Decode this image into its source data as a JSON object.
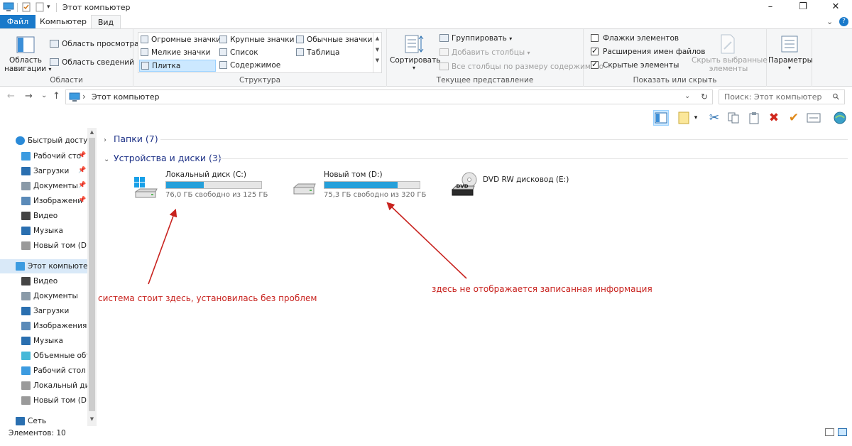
{
  "window": {
    "title": "Этот компьютер",
    "minimize_glyph": "–",
    "maximize_glyph": "❐",
    "close_glyph": "✕",
    "accent": "#1979ca"
  },
  "tabs": {
    "file": "Файл",
    "computer": "Компьютер",
    "view": "Вид"
  },
  "ribbon": {
    "collapse_glyph": "⌄",
    "help_glyph": "?",
    "panes": {
      "nav_pane_line1": "Область",
      "nav_pane_line2": "навигации",
      "preview_pane": "Область просмотра",
      "details_pane": "Область сведений",
      "label": "Области"
    },
    "layout": {
      "items": [
        "Огромные значки",
        "Крупные значки",
        "Обычные значки",
        "Мелкие значки",
        "Список",
        "Таблица",
        "Плитка",
        "Содержимое"
      ],
      "selected": "Плитка",
      "label": "Структура"
    },
    "current_view": {
      "sort": "Сортировать",
      "group": "Группировать",
      "add_columns": "Добавить столбцы",
      "fit_columns": "Все столбцы по размеру содержимого",
      "label": "Текущее представление"
    },
    "show_hide": {
      "item_checkboxes": "Флажки элементов",
      "item_checkboxes_checked": false,
      "file_extensions": "Расширения имен файлов",
      "file_extensions_checked": true,
      "hidden_items": "Скрытые элементы",
      "hidden_items_checked": true,
      "hide_selected_line1": "Скрыть выбранные",
      "hide_selected_line2": "элементы",
      "label": "Показать или скрыть"
    },
    "options": {
      "label": "Параметры"
    }
  },
  "address": {
    "path": "Этот компьютер",
    "search_placeholder": "Поиск: Этот компьютер",
    "back_glyph": "←",
    "forward_glyph": "→",
    "recent_glyph": "⌄",
    "up_glyph": "↑",
    "chevron": "›",
    "dropdown_glyph": "⌄",
    "refresh_glyph": "↻",
    "search_glyph": "⚲"
  },
  "nav": {
    "items": [
      {
        "label": "Быстрый доступ",
        "icon": "star-icon",
        "pinned": false
      },
      {
        "label": "Рабочий сто",
        "icon": "desktop-icon",
        "pinned": true
      },
      {
        "label": "Загрузки",
        "icon": "download-icon",
        "pinned": true
      },
      {
        "label": "Документы",
        "icon": "document-icon",
        "pinned": true
      },
      {
        "label": "Изображени",
        "icon": "pictures-icon",
        "pinned": true
      },
      {
        "label": "Видео",
        "icon": "video-icon",
        "pinned": false
      },
      {
        "label": "Музыка",
        "icon": "music-icon",
        "pinned": false
      },
      {
        "label": "Новый том (D:)",
        "icon": "drive-icon",
        "pinned": false
      },
      {
        "label": "Этот компьютер",
        "icon": "computer-icon",
        "pinned": false
      },
      {
        "label": "Видео",
        "icon": "video-icon",
        "pinned": false
      },
      {
        "label": "Документы",
        "icon": "document-icon",
        "pinned": false
      },
      {
        "label": "Загрузки",
        "icon": "download-icon",
        "pinned": false
      },
      {
        "label": "Изображения",
        "icon": "pictures-icon",
        "pinned": false
      },
      {
        "label": "Музыка",
        "icon": "music-icon",
        "pinned": false
      },
      {
        "label": "Объемные объ",
        "icon": "3d-objects-icon",
        "pinned": false
      },
      {
        "label": "Рабочий стол",
        "icon": "desktop-icon",
        "pinned": false
      },
      {
        "label": "Локальный дис",
        "icon": "drive-icon",
        "pinned": false
      },
      {
        "label": "Новый том (D:)",
        "icon": "drive-icon",
        "pinned": false
      },
      {
        "label": "Сеть",
        "icon": "network-icon",
        "pinned": false
      }
    ],
    "selected": "Этот компьютер",
    "pin_glyph": "📌",
    "scroll_up_glyph": "▲",
    "scroll_down_glyph": "▼"
  },
  "content": {
    "folders_header": "Папки (7)",
    "devices_header": "Устройства и диски (3)",
    "collapsed_glyph": "›",
    "expanded_glyph": "⌄",
    "drives": [
      {
        "name": "Локальный диск (C:)",
        "free_text": "76,0 ГБ свободно из 125 ГБ",
        "used_fraction": 0.392,
        "icon": "windows-drive-icon"
      },
      {
        "name": "Новый том (D:)",
        "free_text": "75,3 ГБ свободно из 320 ГБ",
        "used_fraction": 0.765,
        "icon": "drive-icon"
      },
      {
        "name": "DVD RW дисковод (E:)",
        "free_text": "",
        "used_fraction": null,
        "icon": "dvd-drive-icon"
      }
    ],
    "bar_color": "#26a0da"
  },
  "annotations": {
    "left": "система стоит здесь, установилась без проблем",
    "right": "здесь не отображается записанная информация",
    "color": "#c8231f"
  },
  "status": {
    "items_count": "Элементов: 10"
  }
}
